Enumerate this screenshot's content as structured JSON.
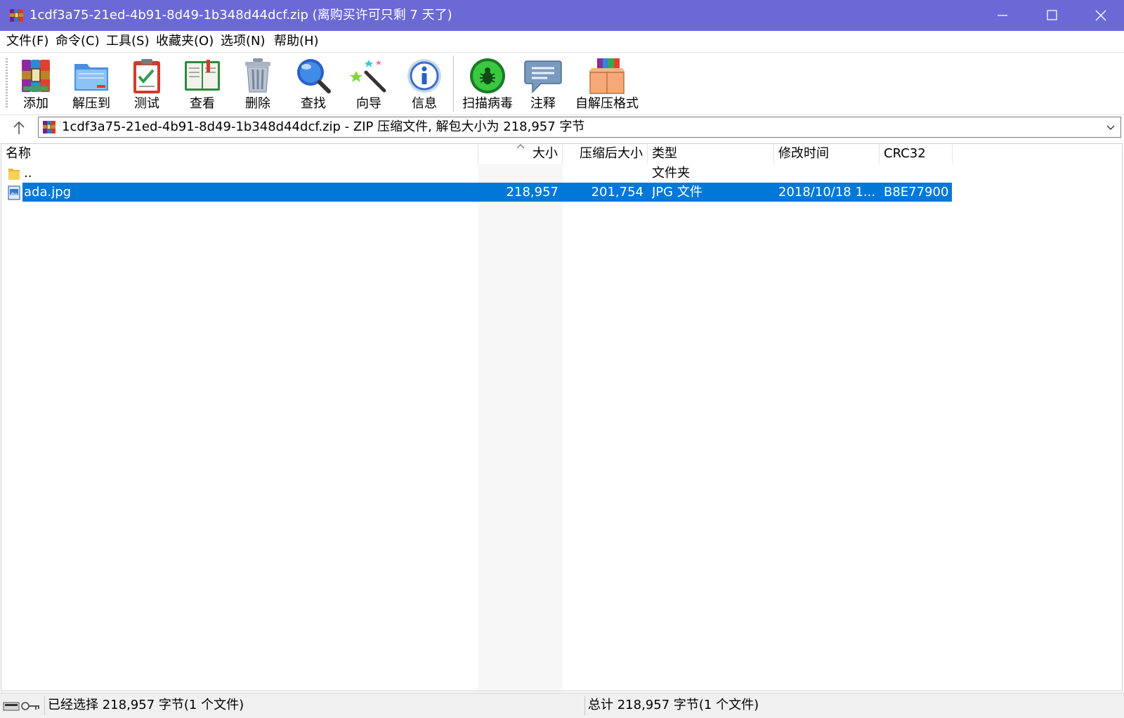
{
  "window": {
    "title": "1cdf3a75-21ed-4b91-8d49-1b348d44dcf.zip (离购买许可只剩 7 天了)",
    "controls": {
      "minimize_icon": "minimize-icon",
      "maximize_icon": "maximize-icon",
      "close_icon": "close-icon"
    },
    "titlebar_color": "#6b69d6"
  },
  "menu": {
    "items": [
      "文件(F)",
      "命令(C)",
      "工具(S)",
      "收藏夹(O)",
      "选项(N)",
      "帮助(H)"
    ]
  },
  "toolbar": {
    "buttons": [
      {
        "label": "添加",
        "icon": "add-archive-icon"
      },
      {
        "label": "解压到",
        "icon": "extract-folder-icon"
      },
      {
        "label": "测试",
        "icon": "test-clipboard-icon"
      },
      {
        "label": "查看",
        "icon": "view-book-icon"
      },
      {
        "label": "删除",
        "icon": "trash-icon"
      },
      {
        "label": "查找",
        "icon": "magnifier-icon"
      },
      {
        "label": "向导",
        "icon": "wizard-wand-icon"
      },
      {
        "label": "信息",
        "icon": "info-icon"
      },
      {
        "label": "扫描病毒",
        "icon": "virus-scan-icon"
      },
      {
        "label": "注释",
        "icon": "comment-icon"
      },
      {
        "label": "自解压格式",
        "icon": "sfx-box-icon"
      }
    ]
  },
  "address": {
    "text": "1cdf3a75-21ed-4b91-8d49-1b348d44dcf.zip - ZIP 压缩文件, 解包大小为 218,957 字节",
    "up_icon": "up-arrow-icon",
    "dropdown_icon": "chevron-down-icon"
  },
  "filelist": {
    "columns": [
      "名称",
      "大小",
      "压缩后大小",
      "类型",
      "修改时间",
      "CRC32"
    ],
    "sorted_column": "大小",
    "rows": [
      {
        "name": "..",
        "size": "",
        "packed": "",
        "type": "文件夹",
        "modified": "",
        "crc": "",
        "icon": "folder-icon",
        "selected": false
      },
      {
        "name": "ada.jpg",
        "size": "218,957",
        "packed": "201,754",
        "type": "JPG 文件",
        "modified": "2018/10/18 1...",
        "crc": "B8E77900",
        "icon": "image-file-icon",
        "selected": true
      }
    ],
    "selection_color": "#0078d7"
  },
  "status": {
    "left": "已经选择 218,957 字节(1 个文件)",
    "right": "总计 218,957 字节(1 个文件)",
    "icons": [
      "drive-icon",
      "key-icon"
    ]
  }
}
